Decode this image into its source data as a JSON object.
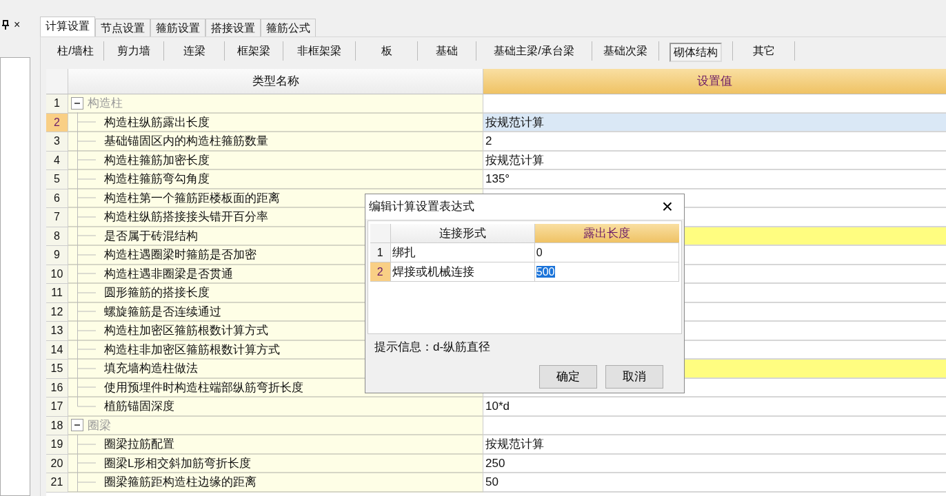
{
  "side_panel": {
    "close": "×"
  },
  "tabs": [
    {
      "label": "计算设置",
      "selected": true
    },
    {
      "label": "节点设置",
      "selected": false
    },
    {
      "label": "箍筋设置",
      "selected": false
    },
    {
      "label": "搭接设置",
      "selected": false
    },
    {
      "label": "箍筋公式",
      "selected": false
    }
  ],
  "subtabs": [
    {
      "label": "柱/墙柱",
      "selected": false
    },
    {
      "label": "剪力墙",
      "selected": false
    },
    {
      "label": "连梁",
      "selected": false
    },
    {
      "label": "框架梁",
      "selected": false
    },
    {
      "label": "非框架梁",
      "selected": false
    },
    {
      "label": "板",
      "selected": false
    },
    {
      "label": "基础",
      "selected": false
    },
    {
      "label": "基础主梁/承台梁",
      "selected": false
    },
    {
      "label": "基础次梁",
      "selected": false
    },
    {
      "label": "砌体结构",
      "selected": true
    },
    {
      "label": "其它",
      "selected": false
    }
  ],
  "grid": {
    "columns": [
      "类型名称",
      "设置值"
    ],
    "rows": [
      {
        "number": "1",
        "kind": "group",
        "name": "构造柱",
        "expanded": true,
        "selected": false,
        "highlighted": false
      },
      {
        "number": "2",
        "kind": "item",
        "name": "构造柱纵筋露出长度",
        "value": "按规范计算",
        "selected": true,
        "highlighted": false
      },
      {
        "number": "3",
        "kind": "item",
        "name": "基础锚固区内的构造柱箍筋数量",
        "value": "2",
        "selected": false,
        "highlighted": false
      },
      {
        "number": "4",
        "kind": "item",
        "name": "构造柱箍筋加密长度",
        "value": "按规范计算",
        "selected": false,
        "highlighted": false
      },
      {
        "number": "5",
        "kind": "item",
        "name": "构造柱箍筋弯勾角度",
        "value": "135°",
        "selected": false,
        "highlighted": false
      },
      {
        "number": "6",
        "kind": "item",
        "name": "构造柱第一个箍筋距楼板面的距离",
        "selected": false,
        "highlighted": false
      },
      {
        "number": "7",
        "kind": "item",
        "name": "构造柱纵筋搭接接头错开百分率",
        "selected": false,
        "highlighted": false
      },
      {
        "number": "8",
        "kind": "item",
        "name": "是否属于砖混结构",
        "selected": false,
        "highlighted": true
      },
      {
        "number": "9",
        "kind": "item",
        "name": "构造柱遇圈梁时箍筋是否加密",
        "selected": false,
        "highlighted": false
      },
      {
        "number": "10",
        "kind": "item",
        "name": "构造柱遇非圈梁是否贯通",
        "selected": false,
        "highlighted": false
      },
      {
        "number": "11",
        "kind": "item",
        "name": "圆形箍筋的搭接长度",
        "selected": false,
        "highlighted": false
      },
      {
        "number": "12",
        "kind": "item",
        "name": "螺旋箍筋是否连续通过",
        "selected": false,
        "highlighted": false
      },
      {
        "number": "13",
        "kind": "item",
        "name": "构造柱加密区箍筋根数计算方式",
        "selected": false,
        "highlighted": false
      },
      {
        "number": "14",
        "kind": "item",
        "name": "构造柱非加密区箍筋根数计算方式",
        "selected": false,
        "highlighted": false
      },
      {
        "number": "15",
        "kind": "item",
        "name": "填充墙构造柱做法",
        "selected": false,
        "highlighted": true
      },
      {
        "number": "16",
        "kind": "item",
        "name": "使用预埋件时构造柱端部纵筋弯折长度",
        "selected": false,
        "highlighted": false
      },
      {
        "number": "17",
        "kind": "item",
        "name": "植筋锚固深度",
        "value": "10*d",
        "selected": false,
        "highlighted": false
      },
      {
        "number": "18",
        "kind": "group",
        "name": "圈梁",
        "expanded": true,
        "selected": false,
        "highlighted": false
      },
      {
        "number": "19",
        "kind": "item",
        "name": "圈梁拉筋配置",
        "value": "按规范计算",
        "selected": false,
        "highlighted": false
      },
      {
        "number": "20",
        "kind": "item",
        "name": "圈梁L形相交斜加筋弯折长度",
        "value": "250",
        "selected": false,
        "highlighted": false
      },
      {
        "number": "21",
        "kind": "item",
        "name": "圈梁箍筋距构造柱边缘的距离",
        "value": "50",
        "selected": false,
        "highlighted": false
      }
    ]
  },
  "dialog": {
    "title": "编辑计算设置表达式",
    "close": "×",
    "columns": [
      "连接形式",
      "露出长度"
    ],
    "rows": [
      {
        "number": "1",
        "name": "绑扎",
        "value": "0",
        "selected": false
      },
      {
        "number": "2",
        "name": "焊接或机械连接",
        "value": "500",
        "selected": true
      }
    ],
    "hint": "提示信息：d-纵筋直径",
    "buttons": [
      "确定",
      "取消"
    ]
  }
}
